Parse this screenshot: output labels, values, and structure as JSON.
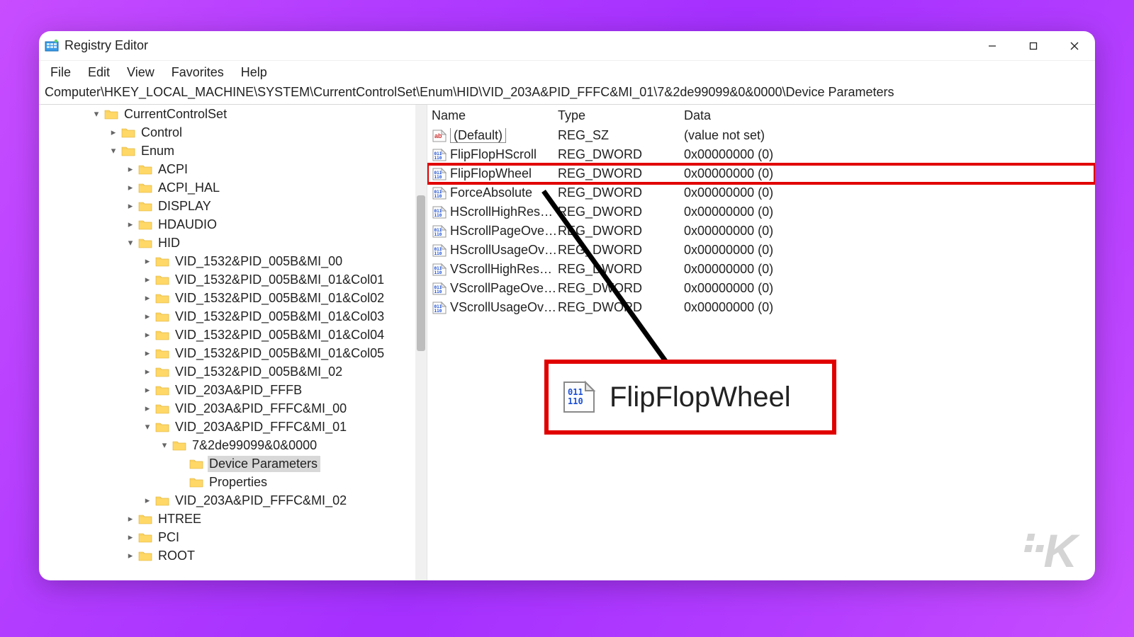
{
  "window": {
    "title": "Registry Editor"
  },
  "menu": {
    "file": "File",
    "edit": "Edit",
    "view": "View",
    "favorites": "Favorites",
    "help": "Help"
  },
  "address": "Computer\\HKEY_LOCAL_MACHINE\\SYSTEM\\CurrentControlSet\\Enum\\HID\\VID_203A&PID_FFFC&MI_01\\7&2de99099&0&0000\\Device Parameters",
  "tree": [
    {
      "indent": 3,
      "exp": "down",
      "label": "CurrentControlSet"
    },
    {
      "indent": 4,
      "exp": "right",
      "label": "Control"
    },
    {
      "indent": 4,
      "exp": "down",
      "label": "Enum"
    },
    {
      "indent": 5,
      "exp": "right",
      "label": "ACPI"
    },
    {
      "indent": 5,
      "exp": "right",
      "label": "ACPI_HAL"
    },
    {
      "indent": 5,
      "exp": "right",
      "label": "DISPLAY"
    },
    {
      "indent": 5,
      "exp": "right",
      "label": "HDAUDIO"
    },
    {
      "indent": 5,
      "exp": "down",
      "label": "HID"
    },
    {
      "indent": 6,
      "exp": "right",
      "label": "VID_1532&PID_005B&MI_00"
    },
    {
      "indent": 6,
      "exp": "right",
      "label": "VID_1532&PID_005B&MI_01&Col01"
    },
    {
      "indent": 6,
      "exp": "right",
      "label": "VID_1532&PID_005B&MI_01&Col02"
    },
    {
      "indent": 6,
      "exp": "right",
      "label": "VID_1532&PID_005B&MI_01&Col03"
    },
    {
      "indent": 6,
      "exp": "right",
      "label": "VID_1532&PID_005B&MI_01&Col04"
    },
    {
      "indent": 6,
      "exp": "right",
      "label": "VID_1532&PID_005B&MI_01&Col05"
    },
    {
      "indent": 6,
      "exp": "right",
      "label": "VID_1532&PID_005B&MI_02"
    },
    {
      "indent": 6,
      "exp": "right",
      "label": "VID_203A&PID_FFFB"
    },
    {
      "indent": 6,
      "exp": "right",
      "label": "VID_203A&PID_FFFC&MI_00"
    },
    {
      "indent": 6,
      "exp": "down",
      "label": "VID_203A&PID_FFFC&MI_01"
    },
    {
      "indent": 7,
      "exp": "down",
      "label": "7&2de99099&0&0000"
    },
    {
      "indent": 8,
      "exp": "none",
      "label": "Device Parameters",
      "selected": true
    },
    {
      "indent": 8,
      "exp": "none",
      "label": "Properties"
    },
    {
      "indent": 6,
      "exp": "right",
      "label": "VID_203A&PID_FFFC&MI_02"
    },
    {
      "indent": 5,
      "exp": "right",
      "label": "HTREE"
    },
    {
      "indent": 5,
      "exp": "right",
      "label": "PCI"
    },
    {
      "indent": 5,
      "exp": "right",
      "label": "ROOT"
    }
  ],
  "columns": {
    "name": "Name",
    "type": "Type",
    "data": "Data"
  },
  "values": [
    {
      "icon": "sz",
      "name": "(Default)",
      "type": "REG_SZ",
      "data": "(value not set)",
      "default": true
    },
    {
      "icon": "bin",
      "name": "FlipFlopHScroll",
      "type": "REG_DWORD",
      "data": "0x00000000 (0)"
    },
    {
      "icon": "bin",
      "name": "FlipFlopWheel",
      "type": "REG_DWORD",
      "data": "0x00000000 (0)",
      "highlight": true
    },
    {
      "icon": "bin",
      "name": "ForceAbsolute",
      "type": "REG_DWORD",
      "data": "0x00000000 (0)"
    },
    {
      "icon": "bin",
      "name": "HScrollHighResol...",
      "type": "REG_DWORD",
      "data": "0x00000000 (0)"
    },
    {
      "icon": "bin",
      "name": "HScrollPageOverr...",
      "type": "REG_DWORD",
      "data": "0x00000000 (0)"
    },
    {
      "icon": "bin",
      "name": "HScrollUsageOve...",
      "type": "REG_DWORD",
      "data": "0x00000000 (0)"
    },
    {
      "icon": "bin",
      "name": "VScrollHighResol...",
      "type": "REG_DWORD",
      "data": "0x00000000 (0)"
    },
    {
      "icon": "bin",
      "name": "VScrollPageOverr...",
      "type": "REG_DWORD",
      "data": "0x00000000 (0)"
    },
    {
      "icon": "bin",
      "name": "VScrollUsageOve...",
      "type": "REG_DWORD",
      "data": "0x00000000 (0)"
    }
  ],
  "callout": {
    "text": "FlipFlopWheel"
  },
  "watermark": "K"
}
